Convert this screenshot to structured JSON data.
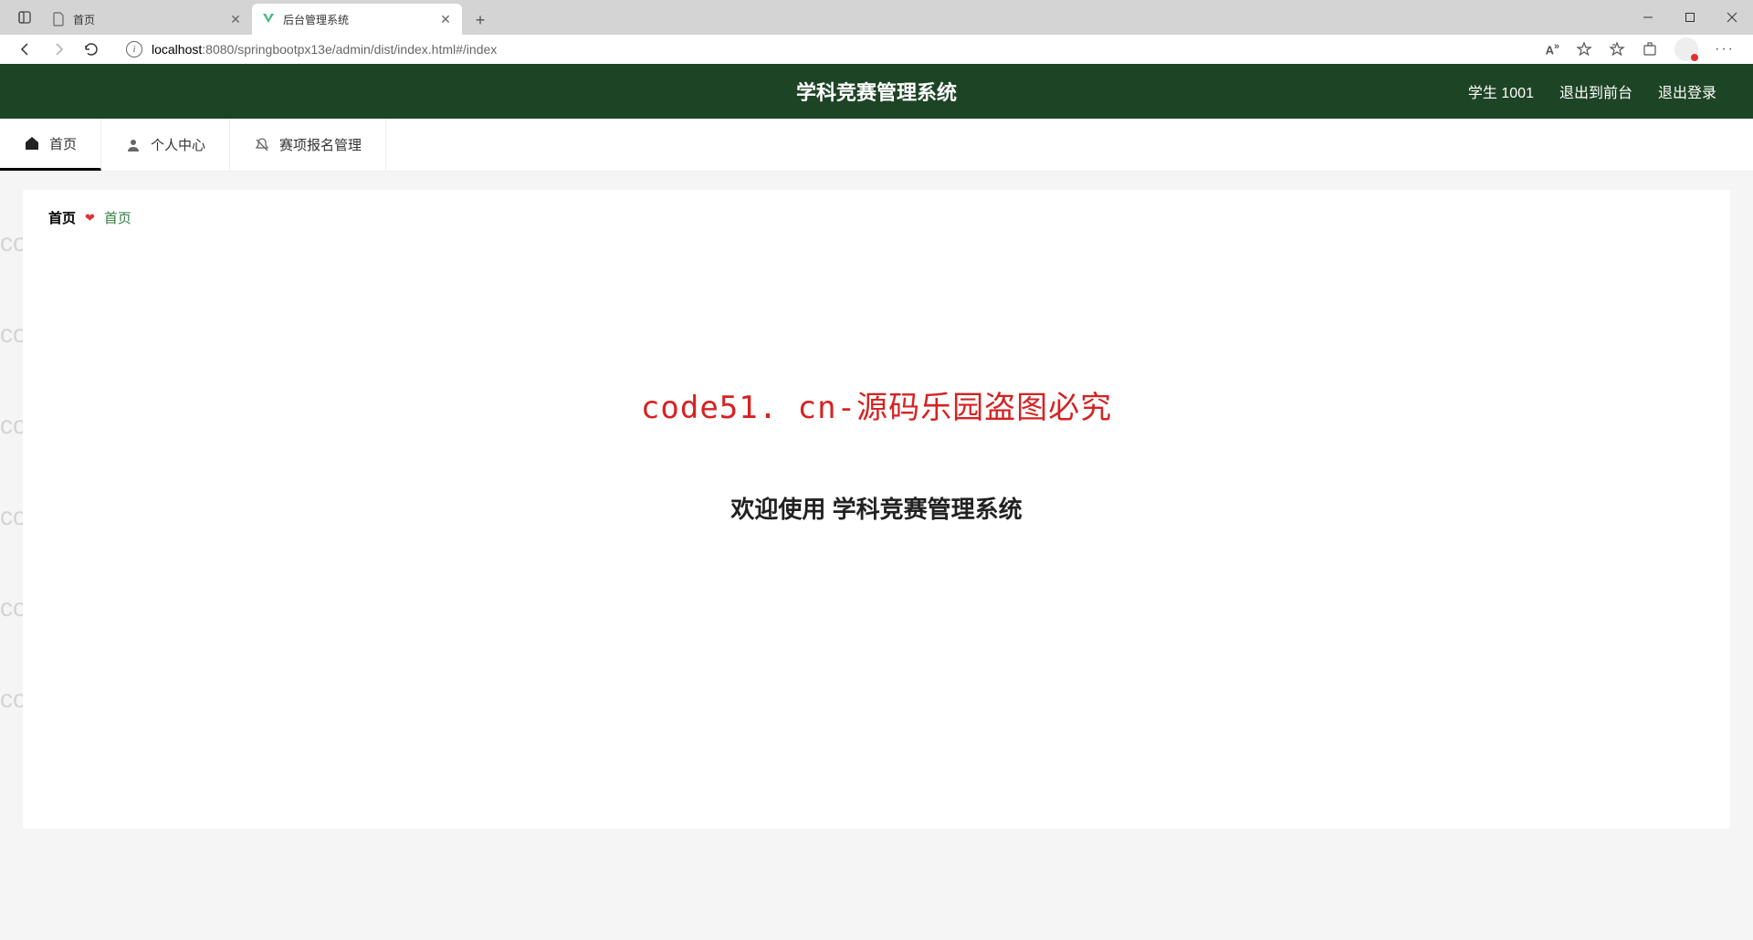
{
  "browser": {
    "tabs": [
      {
        "title": "首页",
        "active": false
      },
      {
        "title": "后台管理系统",
        "active": true
      }
    ],
    "url_host": "localhost",
    "url_port": ":8080",
    "url_path": "/springbootpx13e/admin/dist/index.html#/index"
  },
  "header": {
    "title": "学科竞赛管理系统",
    "user_label": "学生 1001",
    "exit_front": "退出到前台",
    "logout": "退出登录"
  },
  "nav": {
    "items": [
      {
        "label": "首页",
        "icon": "home",
        "active": true
      },
      {
        "label": "个人中心",
        "icon": "user",
        "active": false
      },
      {
        "label": "赛项报名管理",
        "icon": "bell",
        "active": false
      }
    ]
  },
  "breadcrumb": {
    "root": "首页",
    "current": "首页"
  },
  "content": {
    "watermark_notice": "code51. cn-源码乐园盗图必究",
    "welcome": "欢迎使用 学科竞赛管理系统"
  },
  "watermark_text": "code51.cn"
}
